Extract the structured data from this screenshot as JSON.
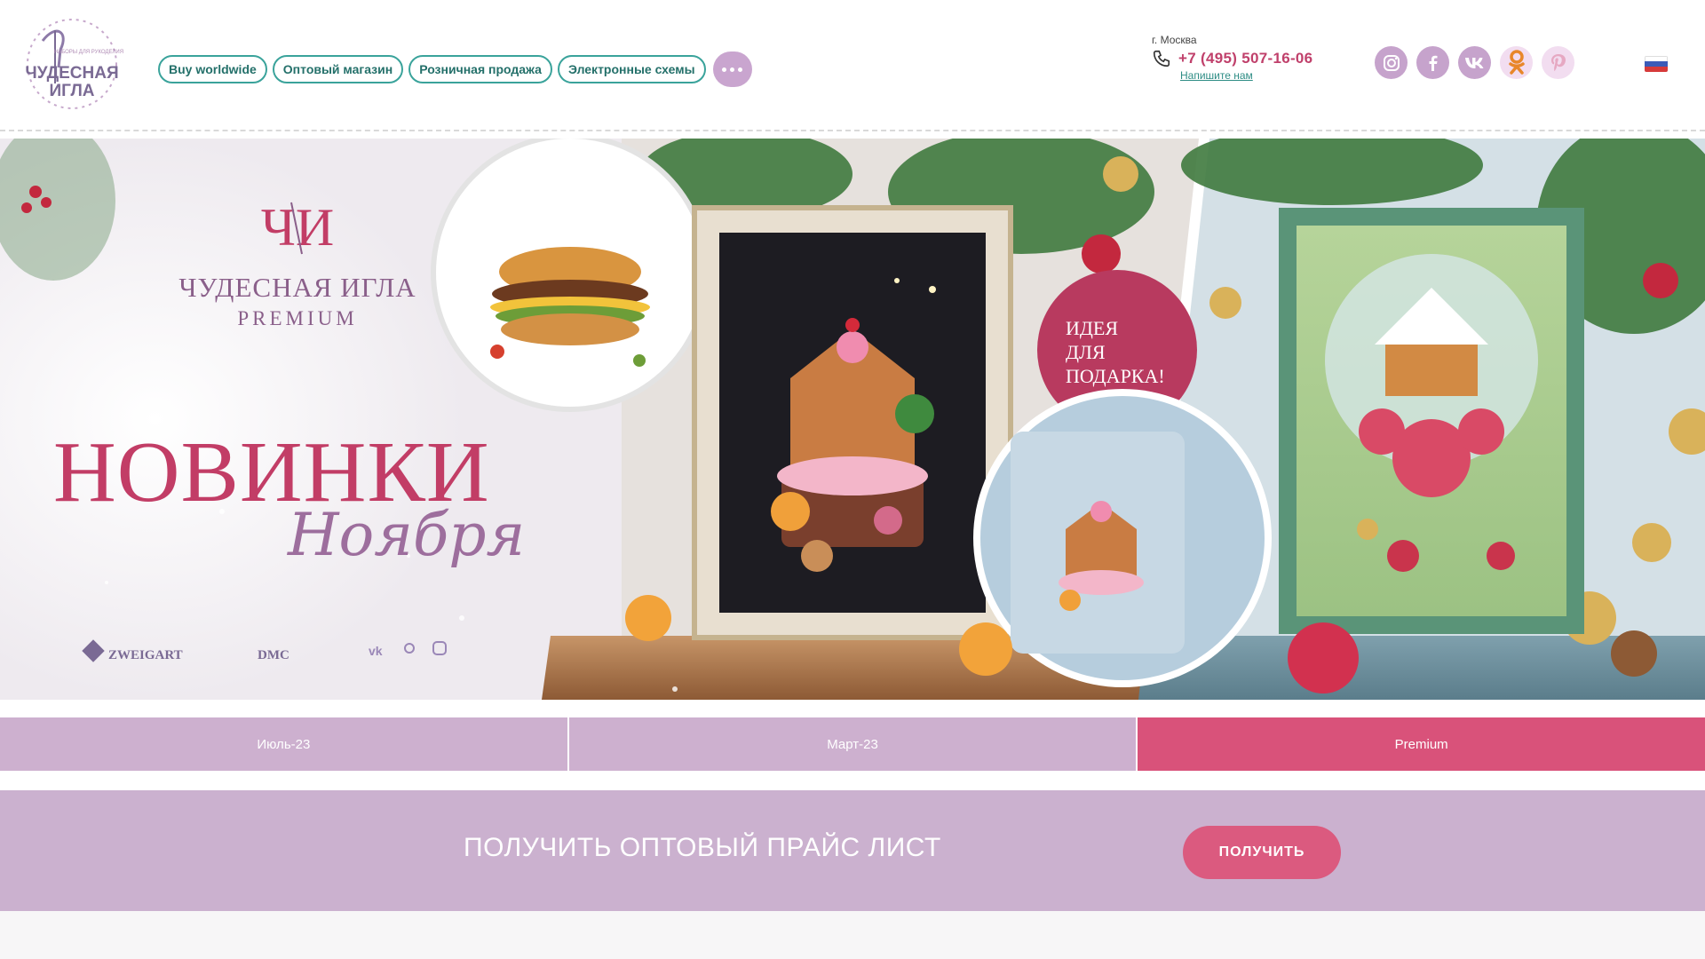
{
  "header": {
    "logo_text": "ЧУДЕСНАЯ ИГЛА",
    "logo_small": "НАБОРЫ ДЛЯ РУКОДЕЛИЯ",
    "nav": [
      {
        "label": "Buy worldwide"
      },
      {
        "label": "Оптовый магазин"
      },
      {
        "label": "Розничная продажа"
      },
      {
        "label": "Электронные схемы"
      }
    ],
    "more_icon": "ellipsis-icon",
    "city": "г. Москва",
    "phone": "+7 (495) 507-16-06",
    "write_us": "Напишите нам",
    "socials": [
      "instagram-icon",
      "facebook-icon",
      "vk-icon",
      "odnoklassniki-icon",
      "pinterest-icon"
    ],
    "language_flag": "russia-flag-icon"
  },
  "banner": {
    "brand_name": "ЧУДЕСНАЯ ИГЛА",
    "brand_sub": "PREMIUM",
    "headline": "НОВИНКИ",
    "headline_sub": "Ноября",
    "gift_lines": [
      "ИДЕЯ",
      "ДЛЯ",
      "ПОДАРКА!"
    ],
    "partner_brands": [
      "ZWEIGART",
      "DMC"
    ]
  },
  "tabs": [
    {
      "label": "Июль-23",
      "active": false
    },
    {
      "label": "Март-23",
      "active": false
    },
    {
      "label": "Premium",
      "active": true
    }
  ],
  "price_bar": {
    "label": "ПОЛУЧИТЬ ОПТОВЫЙ ПРАЙС ЛИСТ",
    "button": "ПОЛУЧИТЬ"
  },
  "colors": {
    "accent_pink": "#d9527a",
    "lilac": "#cdb0cf",
    "teal": "#3aa39b"
  }
}
